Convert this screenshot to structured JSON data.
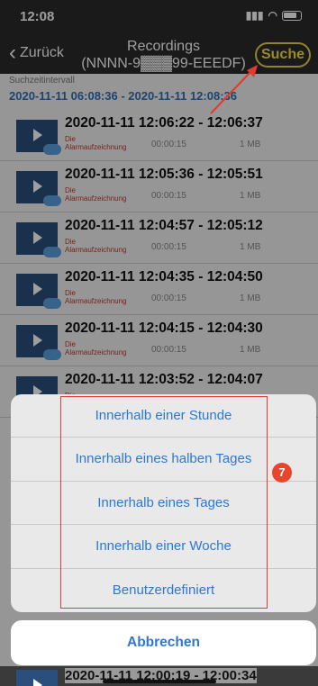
{
  "status": {
    "time": "12:08",
    "signal": "▮▮▮",
    "wifi": "wifi"
  },
  "nav": {
    "back_label": "Zurück",
    "title_line1": "Recordings",
    "title_line2": "(NNNN-9▓▓▓99-EEEDF)",
    "search_label": "Suche"
  },
  "interval": {
    "label": "Suchzeitintervall",
    "value": "2020-11-11 06:08:36 - 2020-11-11 12:08:36"
  },
  "recordings": [
    {
      "times": "2020-11-11  12:06:22 - 12:06:37",
      "type_line1": "Die",
      "type_line2": "Alarmaufzeichnung",
      "duration": "00:00:15",
      "size": "1 MB"
    },
    {
      "times": "2020-11-11  12:05:36 - 12:05:51",
      "type_line1": "Die",
      "type_line2": "Alarmaufzeichnung",
      "duration": "00:00:15",
      "size": "1 MB"
    },
    {
      "times": "2020-11-11  12:04:57 - 12:05:12",
      "type_line1": "Die",
      "type_line2": "Alarmaufzeichnung",
      "duration": "00:00:15",
      "size": "1 MB"
    },
    {
      "times": "2020-11-11  12:04:35 - 12:04:50",
      "type_line1": "Die",
      "type_line2": "Alarmaufzeichnung",
      "duration": "00:00:15",
      "size": "1 MB"
    },
    {
      "times": "2020-11-11  12:04:15 - 12:04:30",
      "type_line1": "Die",
      "type_line2": "Alarmaufzeichnung",
      "duration": "00:00:15",
      "size": "1 MB"
    },
    {
      "times": "2020-11-11  12:03:52 - 12:04:07",
      "type_line1": "Die",
      "type_line2": "",
      "duration": "",
      "size": ""
    }
  ],
  "sheet": {
    "options": [
      "Innerhalb einer Stunde",
      "Innerhalb eines halben Tages",
      "Innerhalb eines Tages",
      "Innerhalb einer Woche",
      "Benutzerdefiniert"
    ],
    "cancel": "Abbrechen"
  },
  "annotation": {
    "badge": "7"
  },
  "bottom_row": {
    "times": "2020-11-11  12:00:19 - 12:00:34"
  },
  "colors": {
    "accent": "#2d78d4",
    "highlight": "#f5e03c",
    "annotation_red": "#e23b2e"
  }
}
